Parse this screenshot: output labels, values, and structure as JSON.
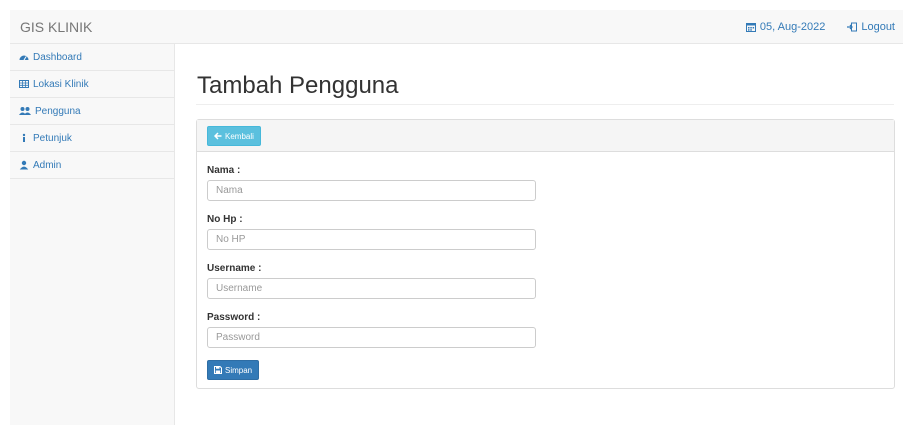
{
  "navbar": {
    "brand": "GIS KLINIK",
    "date": "05, Aug-2022",
    "logout": "Logout"
  },
  "sidebar": {
    "items": [
      {
        "label": "Dashboard",
        "icon": "dashboard-icon"
      },
      {
        "label": "Lokasi Klinik",
        "icon": "table-icon"
      },
      {
        "label": "Pengguna",
        "icon": "users-icon"
      },
      {
        "label": "Petunjuk",
        "icon": "info-icon"
      },
      {
        "label": "Admin",
        "icon": "user-icon"
      }
    ]
  },
  "main": {
    "title": "Tambah Pengguna",
    "back_label": "Kembali",
    "save_label": "Simpan",
    "fields": [
      {
        "label": "Nama :",
        "placeholder": "Nama",
        "value": ""
      },
      {
        "label": "No Hp :",
        "placeholder": "No HP",
        "value": ""
      },
      {
        "label": "Username :",
        "placeholder": "Username",
        "value": ""
      },
      {
        "label": "Password :",
        "placeholder": "Password",
        "value": ""
      }
    ]
  },
  "colors": {
    "link": "#337ab7",
    "info_button": "#5bc0de",
    "primary_button": "#337ab7"
  }
}
